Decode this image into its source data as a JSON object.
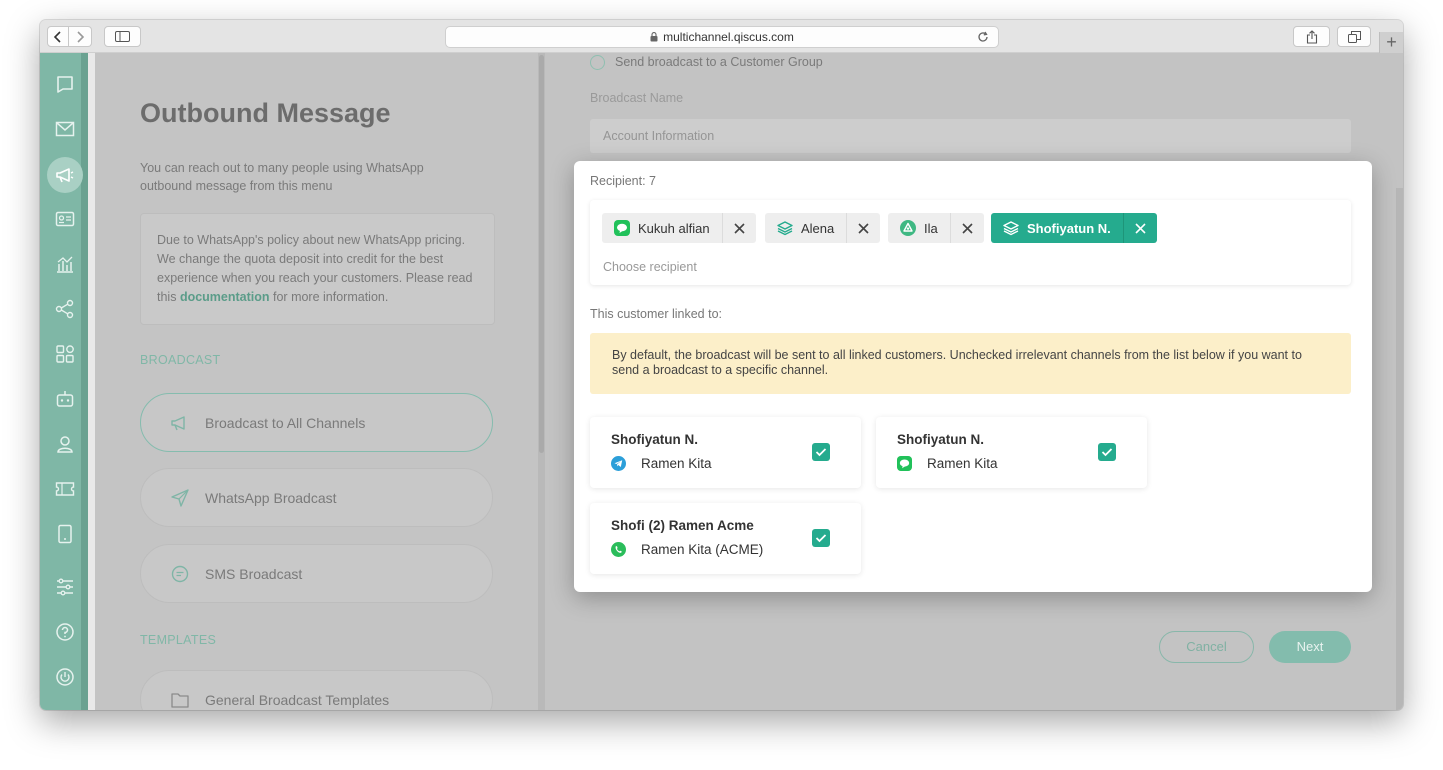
{
  "browser": {
    "url": "multichannel.qiscus.com"
  },
  "left": {
    "title": "Outbound Message",
    "description": "You can reach out to many people using WhatsApp outbound message from this menu",
    "note_pre": "Due to WhatsApp's policy about new WhatsApp pricing. We change the quota deposit into credit for the best experience when you reach your customers. Please read this ",
    "note_link": "documentation",
    "note_post": " for more information.",
    "broadcast_section": "BROADCAST",
    "menu": [
      {
        "label": "Broadcast to All Channels",
        "icon": "megaphone-icon"
      },
      {
        "label": "WhatsApp Broadcast",
        "icon": "send-icon"
      },
      {
        "label": "SMS Broadcast",
        "icon": "sms-icon"
      }
    ],
    "templates_section": "TEMPLATES",
    "templates_item": "General Broadcast Templates"
  },
  "right": {
    "radio_label": "Send broadcast to a Customer Group",
    "broadcast_name_label": "Broadcast Name",
    "broadcast_name_value": "Account Information",
    "cancel": "Cancel",
    "next": "Next"
  },
  "modal": {
    "recipient_label": "Recipient: 7",
    "chips": [
      {
        "label": "Kukuh alfian",
        "channel": "line-icon",
        "selected": false
      },
      {
        "label": "Alena",
        "channel": "layers-icon",
        "selected": false
      },
      {
        "label": "Ila",
        "channel": "qiscus-icon",
        "selected": false
      },
      {
        "label": "Shofiyatun N.",
        "channel": "layers-icon",
        "selected": true
      }
    ],
    "recipient_placeholder": "Choose recipient",
    "linked_label": "This customer linked to:",
    "warning": "By default, the broadcast will be sent to all linked customers. Unchecked irrelevant channels from the list below if you want to send a broadcast to a specific channel.",
    "cards": [
      {
        "name": "Shofiyatun N.",
        "channel": "Ramen Kita",
        "channel_icon": "telegram-icon",
        "checked": true
      },
      {
        "name": "Shofiyatun N.",
        "channel": "Ramen Kita",
        "channel_icon": "line-icon",
        "checked": true
      },
      {
        "name": "Shofi (2) Ramen Acme",
        "channel": "Ramen Kita (ACME)",
        "channel_icon": "whatsapp-icon",
        "checked": true
      }
    ]
  },
  "colors": {
    "accent": "#25ab8e",
    "sidebar": "#7fb7a6",
    "warning_bg": "#fcefc9"
  }
}
